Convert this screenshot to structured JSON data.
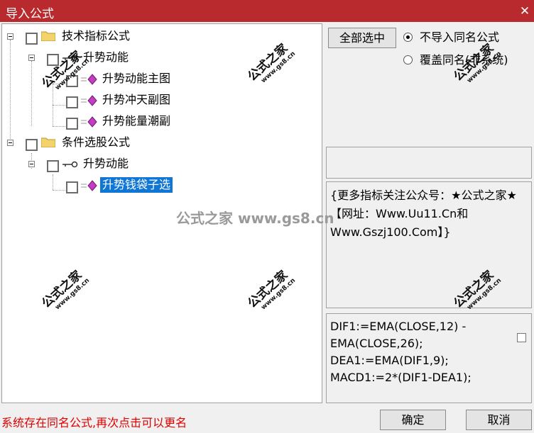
{
  "window": {
    "title": "导入公式",
    "close_glyph": "✕"
  },
  "tree": {
    "technical": {
      "label": "技术指标公式",
      "group": "升势动能",
      "items": [
        "升势动能主图",
        "升势冲天副图",
        "升势能量潮副"
      ]
    },
    "stock_select": {
      "label": "条件选股公式",
      "group": "升势动能",
      "items": [
        "升势钱袋子选"
      ]
    }
  },
  "options": {
    "select_all_label": "全部选中",
    "radio_no_import": "不导入同名公式",
    "radio_overwrite": "覆盖同名(非系统)",
    "selected": "no_import"
  },
  "description": "{更多指标关注公众号：★公式之家★ 【网址：Www.Uu11.Cn和Www.Gszj100.Com】}",
  "code": "DIF1:=EMA(CLOSE,12) -\nEMA(CLOSE,26);\nDEA1:=EMA(DIF1,9);\nMACD1:=2*(DIF1-DEA1);",
  "status": "系统存在同名公式,再次点击可以更名",
  "buttons": {
    "ok": "确定",
    "cancel": "取消"
  },
  "watermark": {
    "title": "公式之家",
    "url": "www.gs8.cn",
    "center": "公式之家 www.gs8.cn"
  }
}
